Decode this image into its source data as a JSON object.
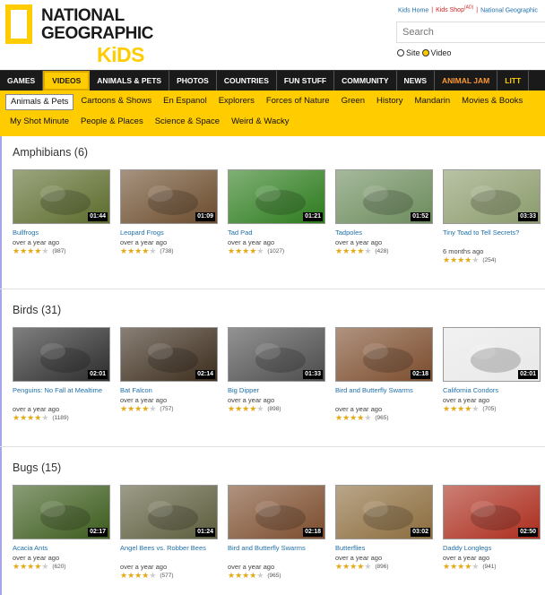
{
  "header": {
    "logo_line1": "NATIONAL",
    "logo_line2": "GEOGRAPHIC",
    "logo_line3": "KiDS",
    "toplinks": {
      "home": "Kids Home",
      "shop": "Kids Shop",
      "shop_sup": "(AD)",
      "natgeo": "National Geographic"
    },
    "search_placeholder": "Search",
    "scope_site": "Site",
    "scope_video": "Video",
    "scope_selected": "Video"
  },
  "mainnav": [
    "GAMES",
    "VIDEOS",
    "ANIMALS & PETS",
    "PHOTOS",
    "COUNTRIES",
    "FUN STUFF",
    "COMMUNITY",
    "NEWS",
    "ANIMAL JAM",
    "LITT"
  ],
  "mainnav_active": "VIDEOS",
  "subnav_row1": [
    "Animals & Pets",
    "Cartoons & Shows",
    "En Espanol",
    "Explorers",
    "Forces of Nature",
    "Green",
    "History",
    "Mandarin",
    "Movies & Books"
  ],
  "subnav_row2": [
    "My Shot Minute",
    "People & Places",
    "Science & Space",
    "Weird & Wacky"
  ],
  "subnav_active": "Animals & Pets",
  "sections": [
    {
      "title": "Amphibians (6)",
      "videos": [
        {
          "title": "Bullfrogs",
          "duration": "01:44",
          "date": "over a year ago",
          "stars": 4,
          "count": "(987)",
          "color": "#5a6a2a"
        },
        {
          "title": "Leopard Frogs",
          "duration": "01:09",
          "date": "over a year ago",
          "stars": 4,
          "count": "(738)",
          "color": "#6a4a2a"
        },
        {
          "title": "Tad Pad",
          "duration": "01:21",
          "date": "over a year ago",
          "stars": 4,
          "count": "(1027)",
          "color": "#2a7a1a"
        },
        {
          "title": "Tadpoles",
          "duration": "01:52",
          "date": "over a year ago",
          "stars": 4,
          "count": "(428)",
          "color": "#6a8a5a"
        },
        {
          "title": "Tiny Toad to Tell Secrets?",
          "duration": "03:33",
          "date": "6 months ago",
          "stars": 4,
          "count": "(254)",
          "color": "#8a9a6a"
        }
      ]
    },
    {
      "title": "Birds (31)",
      "videos": [
        {
          "title": "Penguins: No Fall at Mealtime",
          "duration": "02:01",
          "date": "over a year ago",
          "stars": 4,
          "count": "(1189)",
          "color": "#2a2a2a"
        },
        {
          "title": "Bat Falcon",
          "duration": "02:14",
          "date": "over a year ago",
          "stars": 4,
          "count": "(757)",
          "color": "#3a2a1a"
        },
        {
          "title": "Big Dipper",
          "duration": "01:33",
          "date": "over a year ago",
          "stars": 4,
          "count": "(898)",
          "color": "#4a4a4a"
        },
        {
          "title": "Bird and Butterfly Swarms",
          "duration": "02:18",
          "date": "over a year ago",
          "stars": 4,
          "count": "(965)",
          "color": "#7a4a2a"
        },
        {
          "title": "California Condors",
          "duration": "02:01",
          "date": "over a year ago",
          "stars": 4,
          "count": "(705)",
          "color": "#e8e8e8"
        }
      ]
    },
    {
      "title": "Bugs (15)",
      "videos": [
        {
          "title": "Acacia Ants",
          "duration": "02:17",
          "date": "over a year ago",
          "stars": 4,
          "count": "(620)",
          "color": "#3a5a1a"
        },
        {
          "title": "Angel Bees vs. Robber Bees",
          "duration": "01:24",
          "date": "over a year ago",
          "stars": 4,
          "count": "(577)",
          "color": "#5a5a3a"
        },
        {
          "title": "Bird and Butterfly Swarms",
          "duration": "02:18",
          "date": "over a year ago",
          "stars": 4,
          "count": "(965)",
          "color": "#7a4a2a"
        },
        {
          "title": "Butterflies",
          "duration": "03:02",
          "date": "over a year ago",
          "stars": 4,
          "count": "(896)",
          "color": "#8a6a3a"
        },
        {
          "title": "Daddy Longlegs",
          "duration": "02:50",
          "date": "over a year ago",
          "stars": 4,
          "count": "(941)",
          "color": "#aa2a1a"
        }
      ]
    }
  ]
}
